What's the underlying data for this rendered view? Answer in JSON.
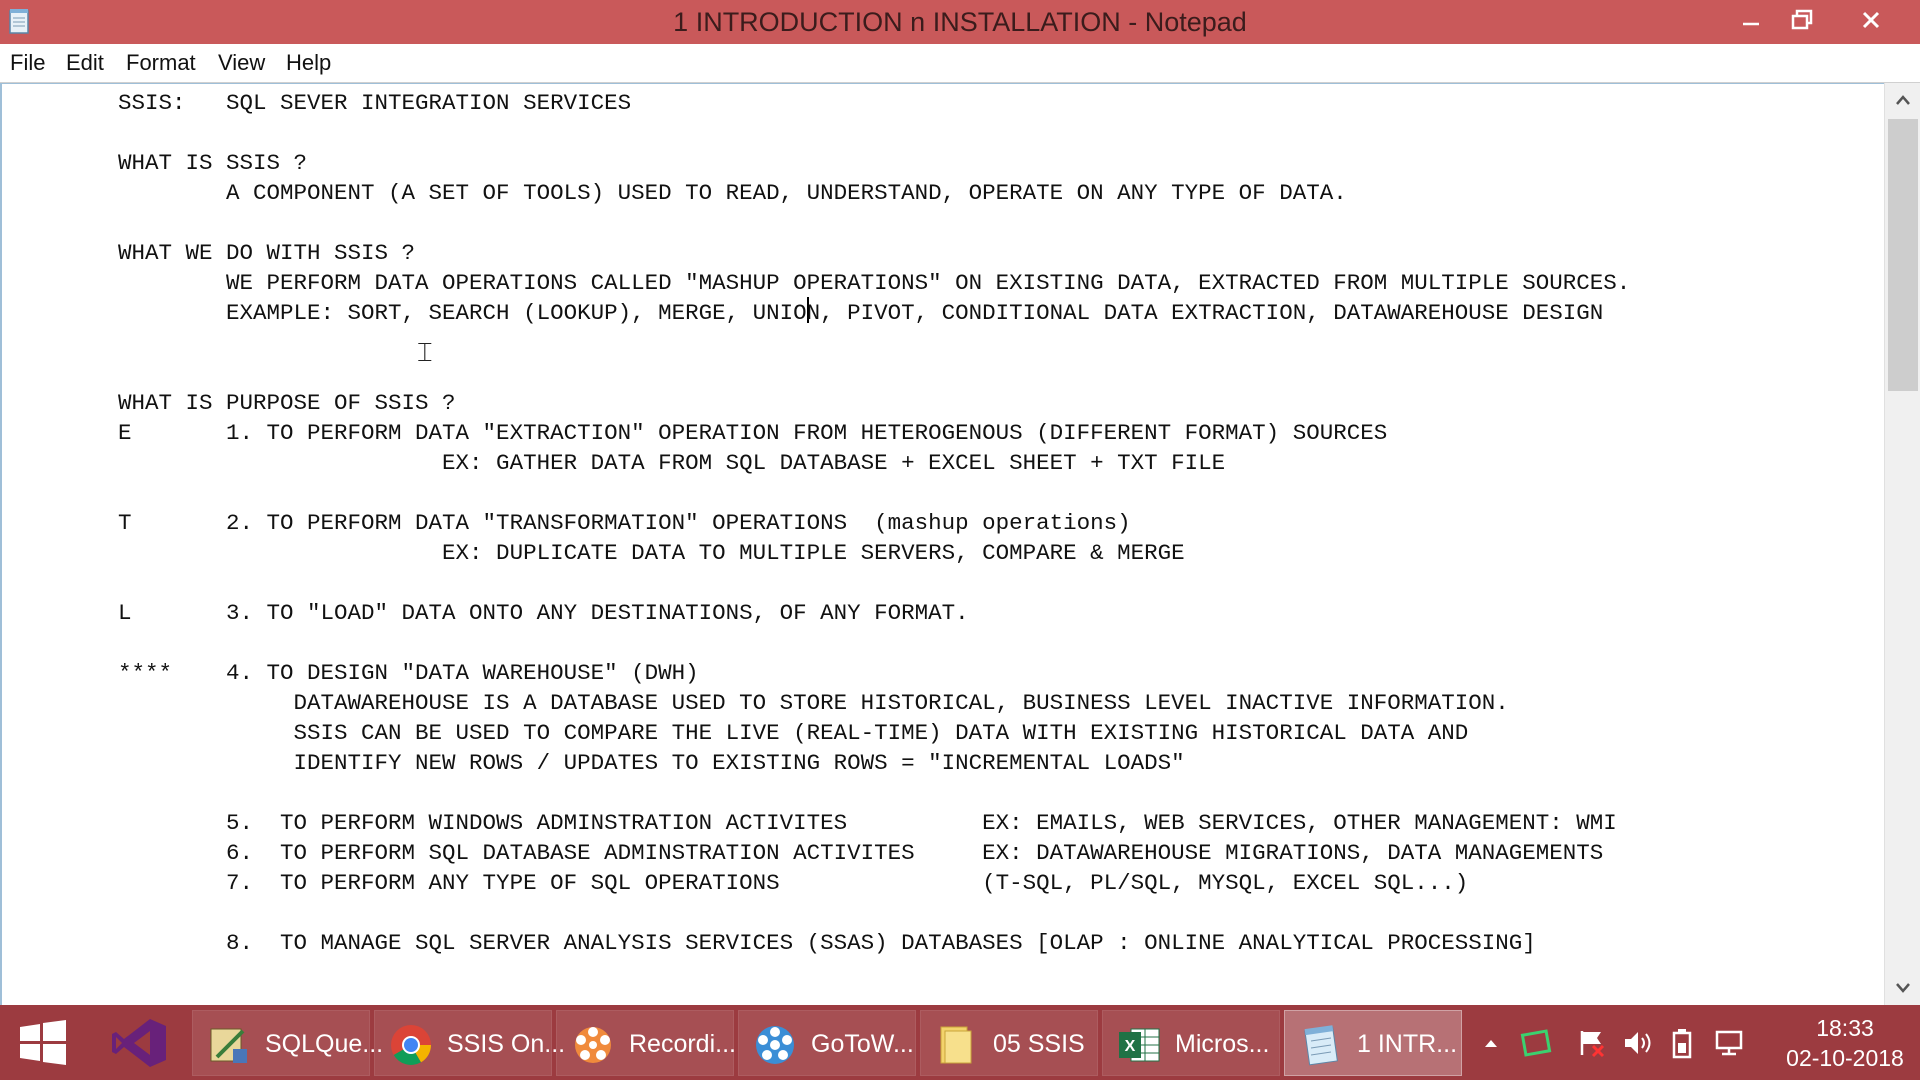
{
  "window": {
    "title": "1 INTRODUCTION n INSTALLATION - Notepad"
  },
  "menu": [
    "File",
    "Edit",
    "Format",
    "View",
    "Help"
  ],
  "document": {
    "lines": [
      "SSIS:   SQL SEVER INTEGRATION SERVICES",
      "",
      "WHAT IS SSIS ?",
      "        A COMPONENT (A SET OF TOOLS) USED TO READ, UNDERSTAND, OPERATE ON ANY TYPE OF DATA.",
      "",
      "WHAT WE DO WITH SSIS ?",
      "        WE PERFORM DATA OPERATIONS CALLED \"MASHUP OPERATIONS\" ON EXISTING DATA, EXTRACTED FROM MULTIPLE SOURCES.",
      "        EXAMPLE: SORT, SEARCH (LOOKUP), MERGE, UNION, PIVOT, CONDITIONAL DATA EXTRACTION, DATAWAREHOUSE DESIGN",
      "",
      "",
      "WHAT IS PURPOSE OF SSIS ?",
      "E       1. TO PERFORM DATA \"EXTRACTION\" OPERATION FROM HETEROGENOUS (DIFFERENT FORMAT) SOURCES",
      "                        EX: GATHER DATA FROM SQL DATABASE + EXCEL SHEET + TXT FILE",
      "",
      "T       2. TO PERFORM DATA \"TRANSFORMATION\" OPERATIONS  (mashup operations)",
      "                        EX: DUPLICATE DATA TO MULTIPLE SERVERS, COMPARE & MERGE",
      "",
      "L       3. TO \"LOAD\" DATA ONTO ANY DESTINATIONS, OF ANY FORMAT.",
      "",
      "****    4. TO DESIGN \"DATA WAREHOUSE\" (DWH)",
      "             DATAWAREHOUSE IS A DATABASE USED TO STORE HISTORICAL, BUSINESS LEVEL INACTIVE INFORMATION.",
      "             SSIS CAN BE USED TO COMPARE THE LIVE (REAL-TIME) DATA WITH EXISTING HISTORICAL DATA AND",
      "             IDENTIFY NEW ROWS / UPDATES TO EXISTING ROWS = \"INCREMENTAL LOADS\"",
      "",
      "        5.  TO PERFORM WINDOWS ADMINSTRATION ACTIVITES          EX: EMAILS, WEB SERVICES, OTHER MANAGEMENT: WMI",
      "        6.  TO PERFORM SQL DATABASE ADMINSTRATION ACTIVITES     EX: DATAWAREHOUSE MIGRATIONS, DATA MANAGEMENTS",
      "        7.  TO PERFORM ANY TYPE OF SQL OPERATIONS               (T-SQL, PL/SQL, MYSQL, EXCEL SQL...)",
      "",
      "        8.  TO MANAGE SQL SERVER ANALYSIS SERVICES (SSAS) DATABASES [OLAP : ONLINE ANALYTICAL PROCESSING]"
    ]
  },
  "taskbar": {
    "items": [
      {
        "label": "SQLQue...",
        "icon": "sql-query-icon"
      },
      {
        "label": "SSIS On...",
        "icon": "chrome-icon"
      },
      {
        "label": "Recordi...",
        "icon": "recording-icon"
      },
      {
        "label": "GoToW...",
        "icon": "gotowebinar-icon"
      },
      {
        "label": "05 SSIS",
        "icon": "folder-icon"
      },
      {
        "label": "Micros...",
        "icon": "excel-icon"
      },
      {
        "label": "1 INTR...",
        "icon": "notepad-icon"
      }
    ],
    "clock": {
      "time": "18:33",
      "date": "02-10-2018"
    }
  },
  "colors": {
    "titlebar": "#c9595a",
    "taskbar": "#9c3b40"
  }
}
